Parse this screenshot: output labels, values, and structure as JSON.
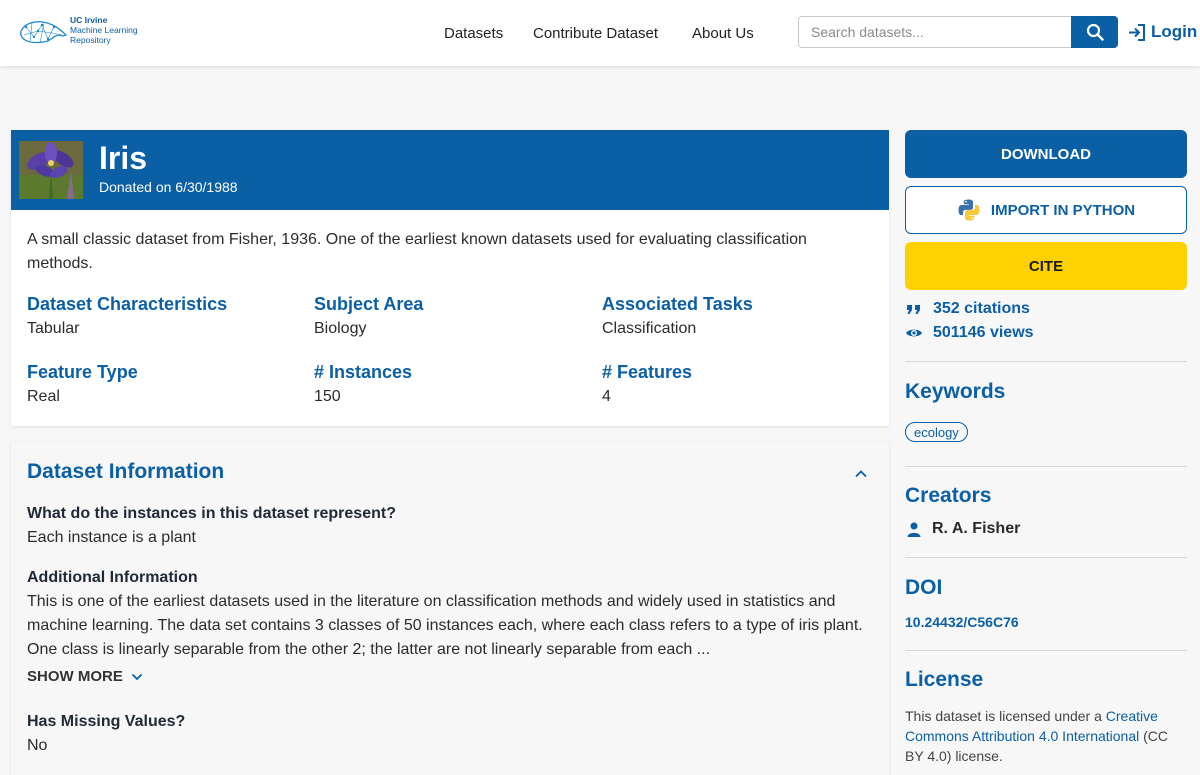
{
  "header": {
    "logo": {
      "line1": "UC Irvine",
      "line2": "Machine Learning",
      "line3": "Repository"
    },
    "nav": {
      "datasets": "Datasets",
      "contribute": "Contribute Dataset",
      "about": "About Us"
    },
    "search": {
      "placeholder": "Search datasets..."
    },
    "login": "Login"
  },
  "dataset": {
    "title": "Iris",
    "donated": "Donated on 6/30/1988",
    "description": "A small classic dataset from Fisher, 1936. One of the earliest known datasets used for evaluating classification methods.",
    "characteristics": [
      {
        "label": "Dataset Characteristics",
        "value": "Tabular"
      },
      {
        "label": "Subject Area",
        "value": "Biology"
      },
      {
        "label": "Associated Tasks",
        "value": "Classification"
      },
      {
        "label": "Feature Type",
        "value": "Real"
      },
      {
        "label": "# Instances",
        "value": "150"
      },
      {
        "label": "# Features",
        "value": "4"
      }
    ]
  },
  "info": {
    "title": "Dataset Information",
    "q1": "What do the instances in this dataset represent?",
    "a1": "Each instance is a plant",
    "q2": "Additional Information",
    "a2": "This is one of the earliest datasets used in the literature on classification methods and widely used in statistics and machine learning.  The data set contains 3 classes of 50 instances each, where each class refers to a type of iris plant.  One class is linearly separable from the other 2; the latter are not linearly separable from each ...",
    "show_more": "SHOW MORE",
    "q3": "Has Missing Values?",
    "a3": "No"
  },
  "sidebar": {
    "download": "DOWNLOAD",
    "import_python": "IMPORT IN PYTHON",
    "cite": "CITE",
    "citations": "352 citations",
    "views": "501146 views",
    "keywords_title": "Keywords",
    "keywords": [
      "ecology"
    ],
    "creators_title": "Creators",
    "creator": "R. A. Fisher",
    "doi_title": "DOI",
    "doi": "10.24432/C56C76",
    "license_title": "License",
    "license_pre": "This dataset is licensed under a ",
    "license_link": "Creative Commons Attribution 4.0 International",
    "license_post": " (CC BY 4.0) license."
  },
  "colors": {
    "primary": "#0b5fa5",
    "cite": "#ffd100",
    "background": "#f7f7f7"
  },
  "icons": [
    "search-icon",
    "login-icon",
    "python-icon",
    "quote-icon",
    "eye-icon",
    "person-icon",
    "chevron-up-icon",
    "chevron-down-icon",
    "iris-thumbnail"
  ]
}
